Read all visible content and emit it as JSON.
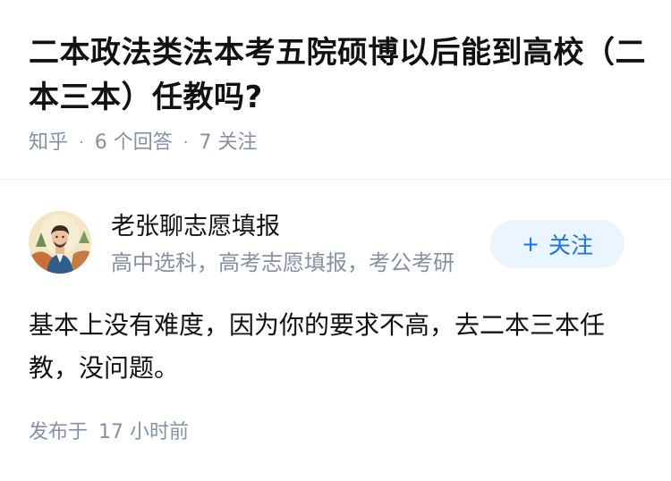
{
  "question": {
    "title": "二本政法类法本考五院硕博以后能到高校（二本三本）任教吗?",
    "source": "知乎",
    "answers_count": "6 个回答",
    "followers_count": "7 关注"
  },
  "answer": {
    "author": {
      "name": "老张聊志愿填报",
      "bio": "高中选科，高考志愿填报，考公考研",
      "follow_label": "关注",
      "follow_icon": "plus-icon"
    },
    "content": "基本上没有难度，因为你的要求不高，去二本三本任教，没问题。",
    "published_prefix": "发布于",
    "published_time": "17 小时前"
  },
  "colors": {
    "primary_text": "#121212",
    "secondary_text": "#8590a6",
    "accent": "#1772f6",
    "button_bg": "#ebf5ff"
  }
}
